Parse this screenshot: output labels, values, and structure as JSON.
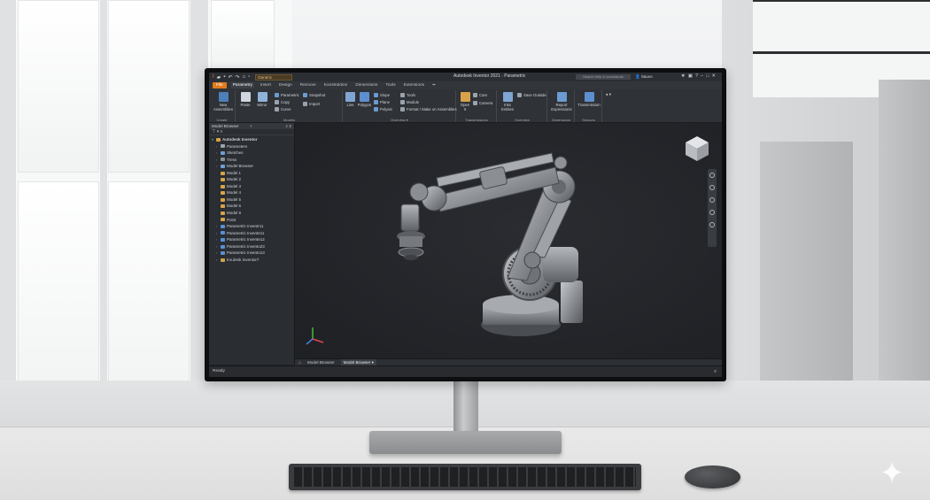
{
  "app": {
    "title": "Autodesk Inventor 2021 · Parametric",
    "workspace_dropdown": "Generic",
    "search_placeholder": "Search help & commands",
    "user": "Sauvo"
  },
  "tabs": [
    {
      "label": "File",
      "kind": "file"
    },
    {
      "label": "Parametry",
      "kind": "active"
    },
    {
      "label": "Insert"
    },
    {
      "label": "Design"
    },
    {
      "label": "Remove"
    },
    {
      "label": "Konstruktion"
    },
    {
      "label": "Dimensions"
    },
    {
      "label": "Tools"
    },
    {
      "label": "Extensions"
    },
    {
      "label": "▪▪"
    }
  ],
  "ribbon": {
    "new_assembly": "New\nAssemblies",
    "group_create": "Create",
    "paste": "Paste",
    "mirror": "Mirror",
    "parametric": "Parametric",
    "copy": "Copy",
    "curve": "Curve",
    "snapshot": "Snapshot",
    "import": "Import",
    "group_models": "Models",
    "line": "Line",
    "polygon": "Polygon",
    "slope": "Slope",
    "plane": "Plane",
    "polyarc": "Polyarc",
    "tools": "Tools",
    "module": "Module",
    "format": "Format / Make on Assemblies",
    "group_overview": "Overview ▾",
    "group_open": "Open\nIt",
    "cam": "Cam",
    "camera": "Camera",
    "group_transmissions": "Transmissions",
    "inks": "Inks\nEntities",
    "save_outside": "Save Outside",
    "group_overview2": "Overview",
    "report": "Report\nExpressions",
    "group_dimensions": "Dimensions",
    "transmission": "Transmission",
    "group_sensors": "Sensors"
  },
  "browser": {
    "header": "Model Browser",
    "tree": [
      {
        "label": "Autodesk Inventor",
        "icon": "assembly",
        "level": 0,
        "arrow": "▾"
      },
      {
        "label": "Parameters",
        "icon": "param",
        "level": 1,
        "arrow": "›"
      },
      {
        "label": "Sketches",
        "icon": "sketch",
        "level": 1,
        "arrow": "›"
      },
      {
        "label": "Tress",
        "icon": "folder-grey",
        "level": 1,
        "arrow": "›"
      },
      {
        "label": "Model Browser",
        "icon": "browser",
        "level": 1,
        "arrow": "›"
      },
      {
        "label": "Model 1",
        "icon": "folder",
        "level": 1,
        "arrow": ""
      },
      {
        "label": "Model 2",
        "icon": "folder",
        "level": 1,
        "arrow": ""
      },
      {
        "label": "Model 3",
        "icon": "folder",
        "level": 1,
        "arrow": ""
      },
      {
        "label": "Model 4",
        "icon": "folder",
        "level": 1,
        "arrow": ""
      },
      {
        "label": "Model 5",
        "icon": "folder",
        "level": 1,
        "arrow": ""
      },
      {
        "label": "Model 6",
        "icon": "folder",
        "level": 1,
        "arrow": ""
      },
      {
        "label": "Model 8",
        "icon": "folder",
        "level": 1,
        "arrow": ""
      },
      {
        "label": "Point",
        "icon": "folder",
        "level": 1,
        "arrow": ""
      },
      {
        "label": "Parametric Inventr11",
        "icon": "part",
        "level": 1,
        "arrow": "›"
      },
      {
        "label": "Parametric Invente11",
        "icon": "part",
        "level": 1,
        "arrow": "›"
      },
      {
        "label": "Parametric Invente12",
        "icon": "part",
        "level": 1,
        "arrow": "›"
      },
      {
        "label": "Parametric Invento23",
        "icon": "part",
        "level": 1,
        "arrow": "›"
      },
      {
        "label": "Parametric Invento13",
        "icon": "part",
        "level": 1,
        "arrow": "›"
      },
      {
        "label": "Inv.desk Inventor7",
        "icon": "constraint",
        "level": 1,
        "arrow": "›"
      }
    ]
  },
  "bottom_tabs": [
    {
      "label": "Model Browser",
      "active": false
    },
    {
      "label": "Model Browser ▾",
      "active": true
    }
  ],
  "status": "Ready",
  "colors": {
    "accent": "#e07b1f",
    "folder": "#d8a24a",
    "part": "#5a8fd6"
  }
}
